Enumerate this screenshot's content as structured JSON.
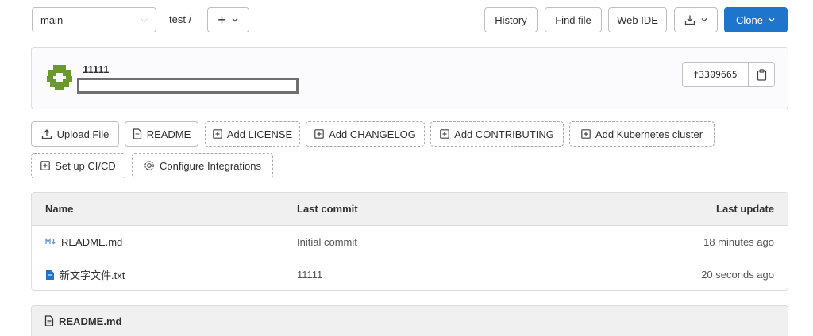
{
  "repo": {
    "branch": "main",
    "breadcrumb": "test /",
    "add_label": "+"
  },
  "toolbar": {
    "history": "History",
    "find_file": "Find file",
    "web_ide": "Web IDE",
    "clone": "Clone"
  },
  "commit": {
    "title": "11111",
    "sha": "f3309665"
  },
  "actions": {
    "upload_file": "Upload File",
    "readme": "README",
    "add_license": "Add LICENSE",
    "add_changelog": "Add CHANGELOG",
    "add_contributing": "Add CONTRIBUTING",
    "add_k8s": "Add Kubernetes cluster",
    "setup_ci": "Set up CI/CD",
    "configure_integrations": "Configure Integrations"
  },
  "table": {
    "headers": {
      "name": "Name",
      "last_commit": "Last commit",
      "last_update": "Last update"
    },
    "rows": [
      {
        "name": "README.md",
        "icon": "markdown-icon",
        "commit": "Initial commit",
        "updated": "18 minutes ago"
      },
      {
        "name": "新文字文件.txt",
        "icon": "text-file-icon",
        "commit": "11111",
        "updated": "20 seconds ago"
      }
    ]
  },
  "readme_header": {
    "title": "README.md"
  },
  "colors": {
    "primary": "#1f75cb",
    "markdown_icon": "#6a9bd8",
    "text_file_icon": "#1f75cb",
    "avatar": "#6a9a2f"
  }
}
